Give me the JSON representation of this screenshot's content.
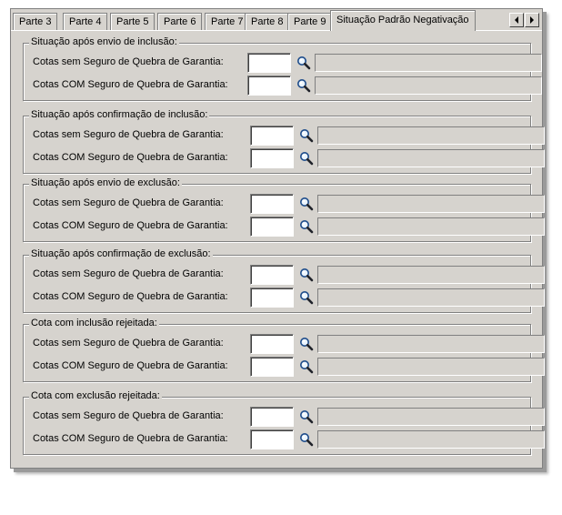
{
  "tabs": [
    {
      "label": "Parte 3",
      "active": false
    },
    {
      "label": "Parte 4",
      "active": false
    },
    {
      "label": "Parte 5",
      "active": false
    },
    {
      "label": "Parte 6",
      "active": false
    },
    {
      "label": "Parte 7",
      "active": false
    },
    {
      "label": "Parte 8",
      "active": false
    },
    {
      "label": "Parte 9",
      "active": false
    },
    {
      "label": "Situação Padrão Negativação",
      "active": true
    }
  ],
  "scroll": {
    "left_icon": "arrow-left-icon",
    "right_icon": "arrow-right-icon"
  },
  "row_labels": {
    "sem": "Cotas sem Seguro de Quebra de Garantia:",
    "com": "Cotas COM Seguro de Quebra de Garantia:"
  },
  "groups": [
    {
      "title": "Situação após envio de inclusão:",
      "sem_value": "",
      "com_value": ""
    },
    {
      "title": "Situação após confirmação de inclusão:",
      "sem_value": "",
      "com_value": ""
    },
    {
      "title": "Situação após envio de exclusão:",
      "sem_value": "",
      "com_value": ""
    },
    {
      "title": "Situação após confirmação de exclusão:",
      "sem_value": "",
      "com_value": ""
    },
    {
      "title": "Cota com inclusão rejeitada:",
      "sem_value": "",
      "com_value": ""
    },
    {
      "title": "Cota com exclusão rejeitada:",
      "sem_value": "",
      "com_value": ""
    }
  ],
  "colors": {
    "panel": "#d6d3ce",
    "shadow": "#808080"
  }
}
